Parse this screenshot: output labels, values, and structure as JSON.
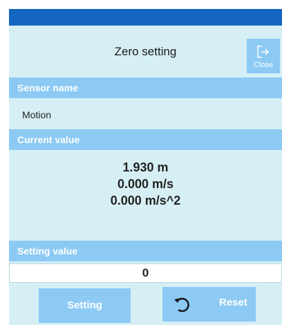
{
  "window": {
    "title": "Zero setting",
    "close_label": "Close",
    "close_icon": "exit-icon"
  },
  "sensor": {
    "header": "Sensor name",
    "value": "Motion"
  },
  "current": {
    "header": "Current value",
    "position": "1.930 m",
    "velocity": "0.000 m/s",
    "acceleration": "0.000 m/s^2"
  },
  "setting": {
    "header": "Setting value",
    "value": "0"
  },
  "buttons": {
    "setting_label": "Setting",
    "reset_label": "Reset",
    "reset_icon": "undo-icon"
  },
  "colors": {
    "topbar": "#1566c0",
    "panel": "#d6eff5",
    "accent": "#8ccaf4"
  }
}
